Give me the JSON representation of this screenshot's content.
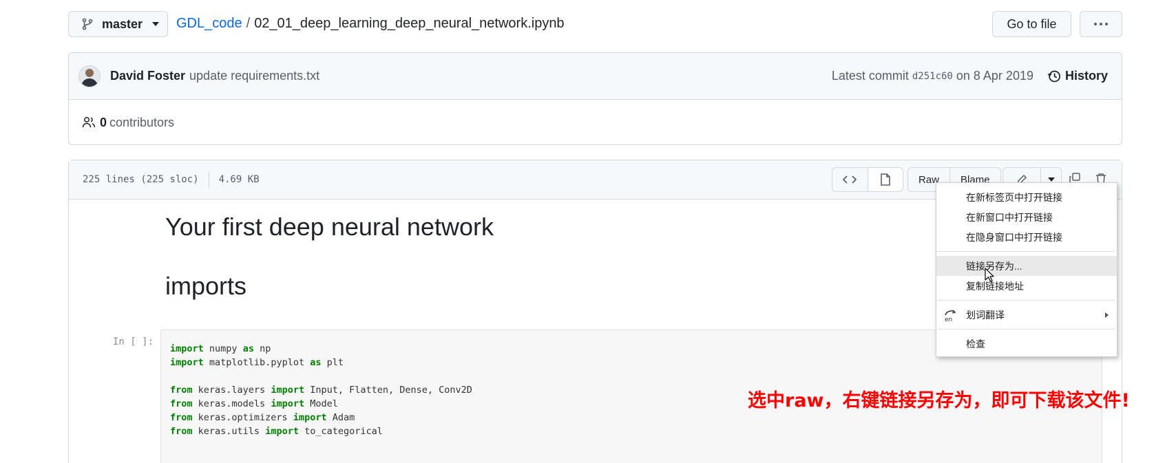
{
  "topbar": {
    "branch": "master",
    "repo": "GDL_code",
    "separator": "/",
    "file": "02_01_deep_learning_deep_neural_network.ipynb",
    "goto_file": "Go to file"
  },
  "commit": {
    "author": "David Foster",
    "message": "update requirements.txt",
    "latest_prefix": "Latest commit",
    "sha": "d251c60",
    "date": "on 8 Apr 2019",
    "history": "History",
    "contributors_count": "0",
    "contributors_label": "contributors"
  },
  "file": {
    "lines": "225 lines (225 sloc)",
    "size": "4.69 KB",
    "raw": "Raw",
    "blame": "Blame"
  },
  "notebook": {
    "title": "Your first deep neural network",
    "heading": "imports",
    "cell_label": "In [ ]:",
    "code": [
      {
        "kw1": "import",
        "mid": " numpy ",
        "kw2": "as",
        "rest": " np"
      },
      {
        "kw1": "import",
        "mid": " matplotlib.pyplot ",
        "kw2": "as",
        "rest": " plt"
      },
      {
        "kw1": "",
        "mid": "",
        "kw2": "",
        "rest": ""
      },
      {
        "kw1": "from",
        "mid": " keras.layers ",
        "kw2": "import",
        "rest": " Input, Flatten, Dense, Conv2D"
      },
      {
        "kw1": "from",
        "mid": " keras.models ",
        "kw2": "import",
        "rest": " Model"
      },
      {
        "kw1": "from",
        "mid": " keras.optimizers ",
        "kw2": "import",
        "rest": " Adam"
      },
      {
        "kw1": "from",
        "mid": " keras.utils ",
        "kw2": "import",
        "rest": " to_categorical"
      }
    ]
  },
  "context_menu": {
    "items": [
      "在新标签页中打开链接",
      "在新窗口中打开链接",
      "在隐身窗口中打开链接",
      "链接另存为...",
      "复制链接地址",
      "划词翻译",
      "检查"
    ],
    "translate_icon_text": "en"
  },
  "annotation": "选中raw，右键链接另存为，即可下载该文件!",
  "colors": {
    "link": "#0969da",
    "annotation": "#ff0000",
    "keyword": "#008000"
  }
}
